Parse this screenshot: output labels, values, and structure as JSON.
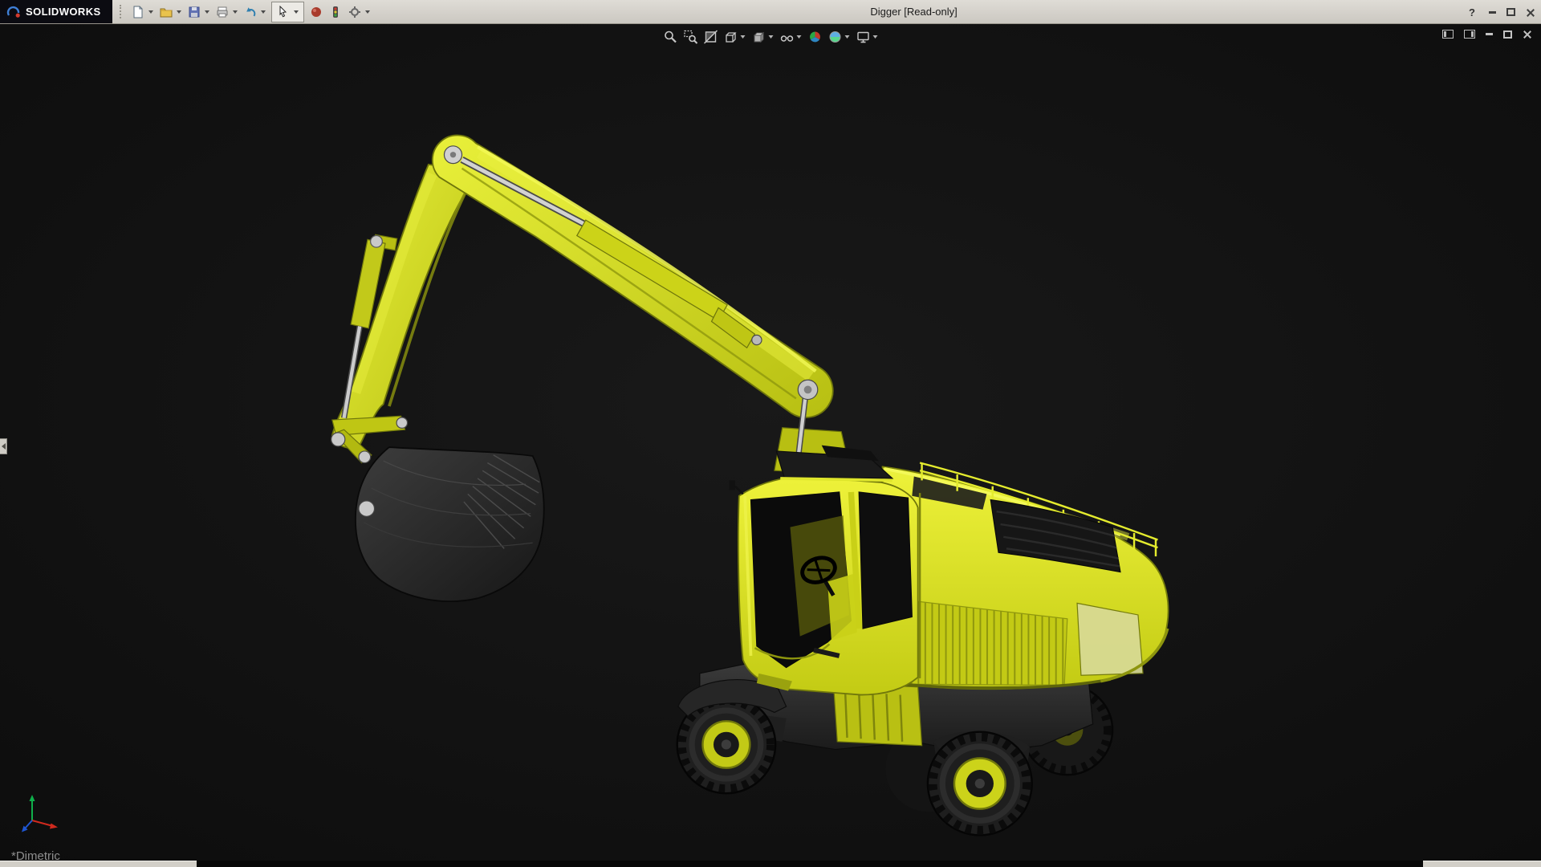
{
  "window": {
    "title": "Digger [Read-only]",
    "brand": "SOLIDWORKS",
    "help_glyph": "?",
    "controls": [
      "help",
      "minimize",
      "maximize",
      "close"
    ]
  },
  "standard_toolbar": {
    "items": [
      "new-document",
      "open",
      "save",
      "print",
      "undo",
      "select",
      "edit-color",
      "rebuild",
      "options"
    ]
  },
  "heads_up_toolbar": {
    "items": [
      "zoom-to-fit",
      "zoom-to-area",
      "section-view",
      "view-orientation",
      "display-style",
      "hide-show-items",
      "edit-appearance",
      "apply-scene",
      "view-settings"
    ]
  },
  "document_controls": [
    "feature-pane",
    "display-pane",
    "minimize",
    "restore",
    "close"
  ],
  "viewport": {
    "view_label": "*Dimetric",
    "background_color": "#121212"
  },
  "model": {
    "name": "Digger",
    "primary_color": "#d9e021",
    "dark_metal_color": "#262626",
    "pin_color": "#c9c9c9"
  }
}
